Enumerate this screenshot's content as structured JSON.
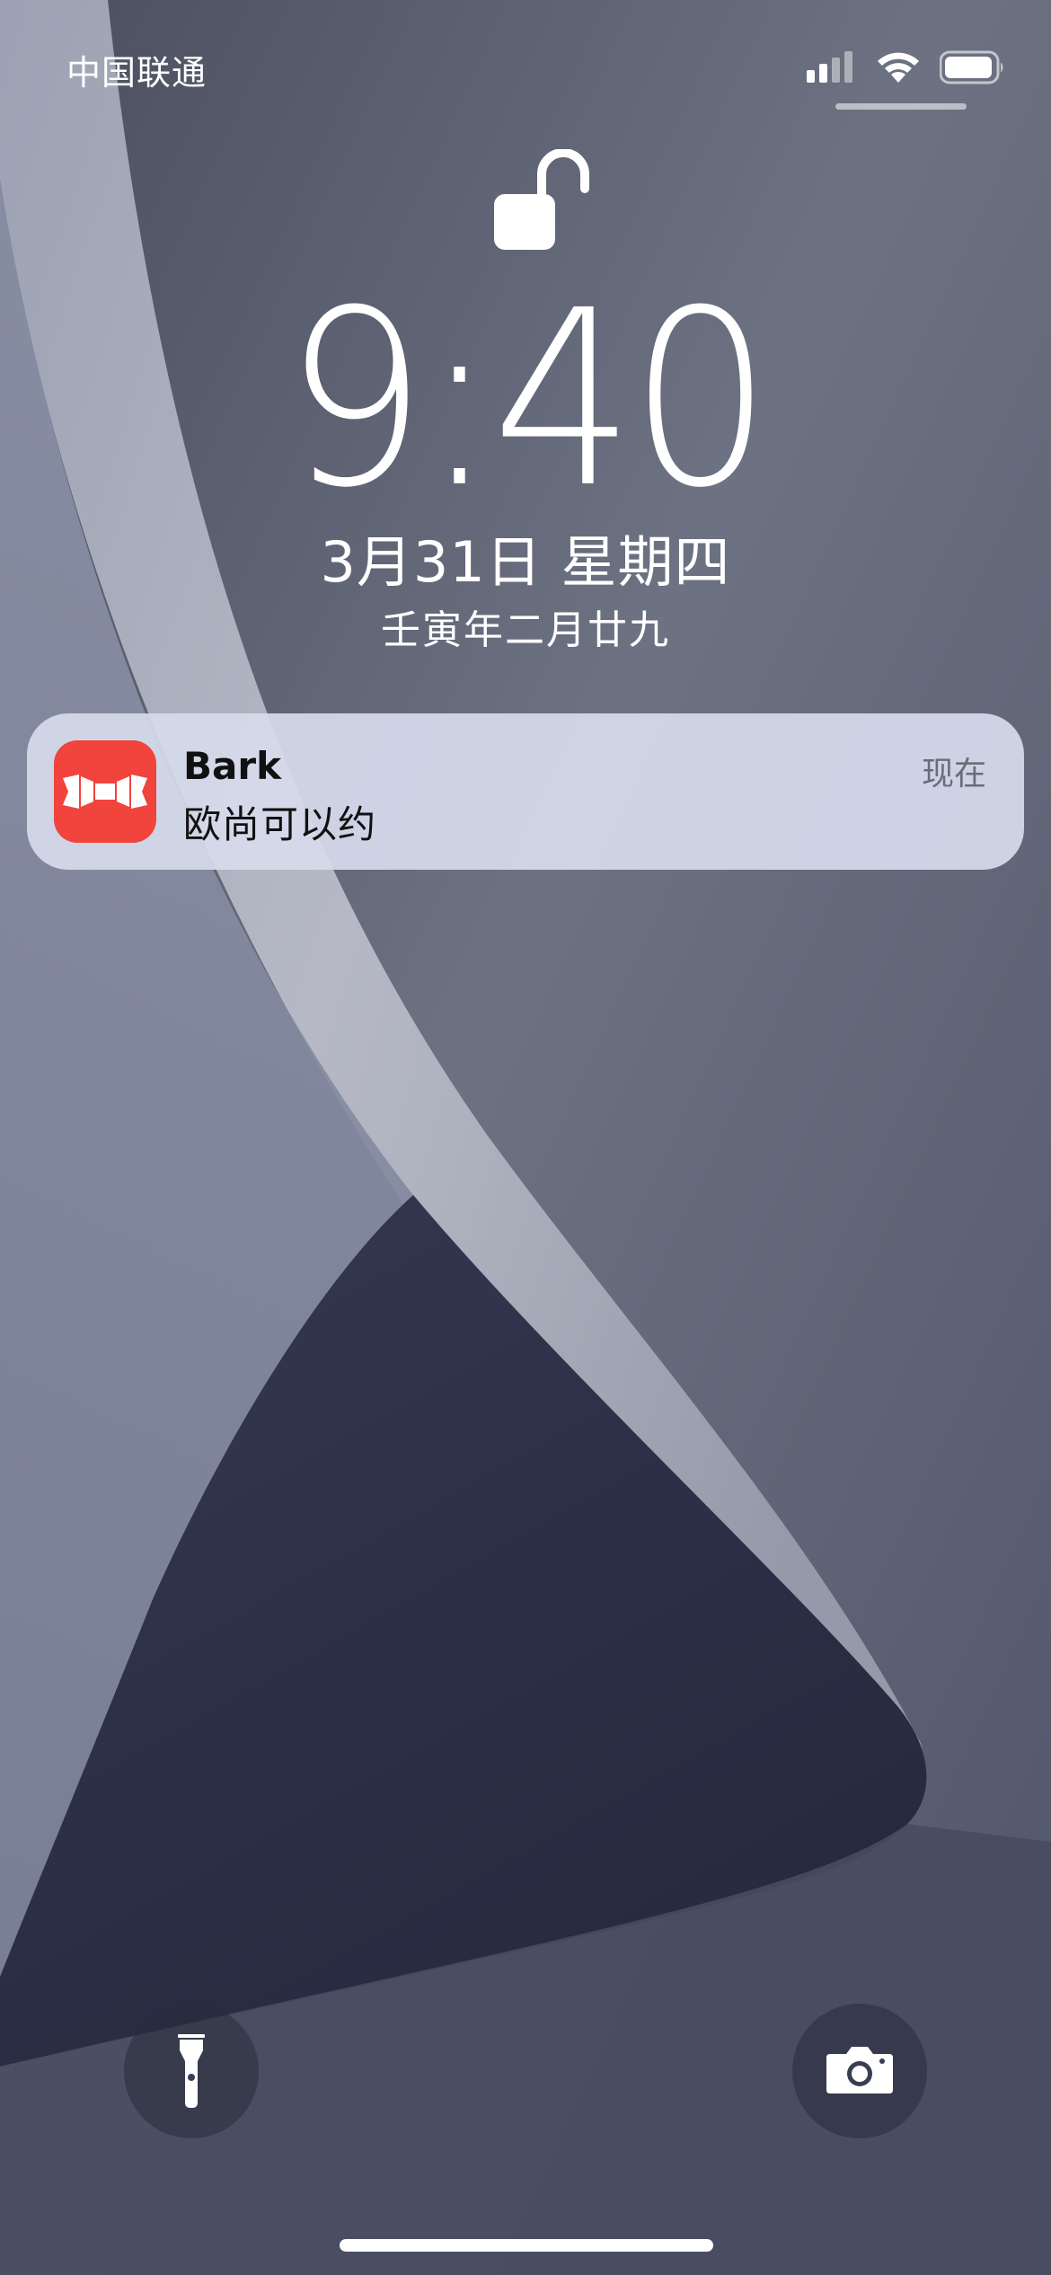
{
  "status_bar": {
    "carrier": "中国联通",
    "icons": [
      "cellular-signal-icon",
      "wifi-icon",
      "battery-icon"
    ],
    "battery_level": 0.9
  },
  "lock": {
    "icon": "unlocked-padlock-icon"
  },
  "clock": {
    "time": "9:40",
    "date": "3月31日 星期四",
    "lunar_date": "壬寅年二月廿九"
  },
  "notification": {
    "app_name": "Bark",
    "message": "欧尚可以约",
    "time": "现在",
    "app_icon": "bark-app-icon",
    "app_icon_color": "#f0443c"
  },
  "quick_actions": {
    "left_icon": "flashlight-icon",
    "right_icon": "camera-icon"
  },
  "colors": {
    "notification_background": "#d6daec",
    "wallpaper_dark": "#2c2f45",
    "wallpaper_light": "#b8bcc8"
  }
}
